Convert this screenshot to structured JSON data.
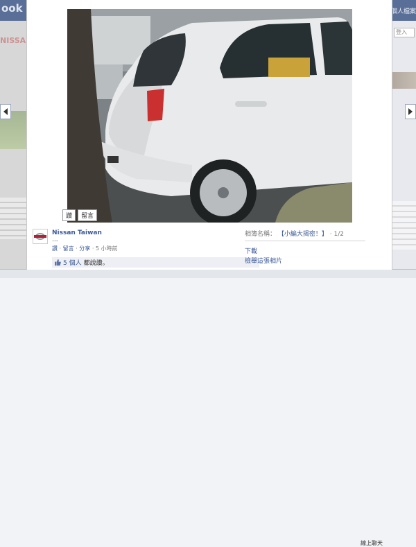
{
  "background": {
    "brand": "ook",
    "account_link": "個人檔案",
    "left_banner": "NISSA",
    "search_placeholder": "登入",
    "chat_text": "線上聊天"
  },
  "viewer": {
    "photo_alt": "white hatchback rear three-quarter view",
    "photo_actions": [
      {
        "label": "讚"
      },
      {
        "label": "留言"
      }
    ],
    "owner_name": "Nissan Taiwan",
    "caption": "...",
    "actions": {
      "like": "讚",
      "comment": "留言",
      "share": "分享",
      "separator": "·",
      "time": "5 小時前"
    },
    "likes": {
      "count_text": "5 個人",
      "suffix": "都說讚。"
    },
    "album": {
      "prefix": "相簿名稱：",
      "name": "【小編大揭密！】",
      "position": "1/2"
    },
    "download": "下載",
    "report": "檢舉這張相片"
  },
  "colors": {
    "link": "#3b5998",
    "header": "#5a6f98",
    "likes_bg": "#edeff4"
  }
}
